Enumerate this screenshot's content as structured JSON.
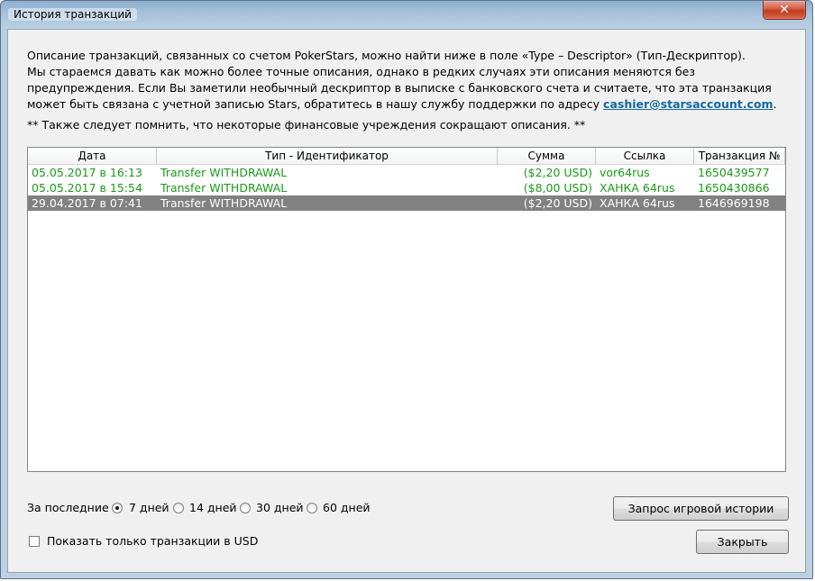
{
  "window": {
    "title": "История транзакций",
    "close_label": "✕"
  },
  "description": {
    "line1": "Описание транзакций, связанных со счетом PokerStars, можно найти ниже в поле «Type – Descriptor» (Тип-Дескриптор).",
    "line2_before_link": "Мы стараемся давать как можно более точные описания, однако в редких случаях эти описания меняются без предупреждения. Если Вы заметили необычный дескриптор в выписке с банковского счета и считаете, что эта транзакция может быть связана с учетной записью Stars, обратитесь в нашу службу поддержки по адресу ",
    "link": "cashier@starsaccount.com",
    "after_link": ".",
    "note": "** Также следует помнить, что некоторые финансовые учреждения сокращают описания. **"
  },
  "table": {
    "columns": [
      "Дата",
      "Тип - Идентификатор",
      "Сумма",
      "Ссылка",
      "Транзакция №"
    ],
    "rows": [
      {
        "date": "05.05.2017 в 16:13",
        "type": "Transfer WITHDRAWAL",
        "sum": "($2,20 USD)",
        "ref": "vor64rus",
        "txn": "1650439577",
        "color": "#1a9a1a",
        "selected": false
      },
      {
        "date": "05.05.2017 в 15:54",
        "type": "Transfer WITHDRAWAL",
        "sum": "($8,00 USD)",
        "ref": "ХАНКА 64rus",
        "txn": "1650430866",
        "color": "#1a9a1a",
        "selected": false
      },
      {
        "date": "29.04.2017 в 07:41",
        "type": "Transfer WITHDRAWAL",
        "sum": "($2,20 USD)",
        "ref": "ХАНКА 64rus",
        "txn": "1646969198",
        "color": "#ffffff",
        "selected": true
      }
    ]
  },
  "period": {
    "label": "За последние",
    "options": [
      {
        "label": "7 дней",
        "selected": true
      },
      {
        "label": "14 дней",
        "selected": false
      },
      {
        "label": "30 дней",
        "selected": false
      },
      {
        "label": "60 дней",
        "selected": false
      }
    ]
  },
  "usd_only": {
    "label": "Показать только транзакции в USD",
    "checked": false
  },
  "buttons": {
    "history": "Запрос игровой истории",
    "close": "Закрыть"
  }
}
